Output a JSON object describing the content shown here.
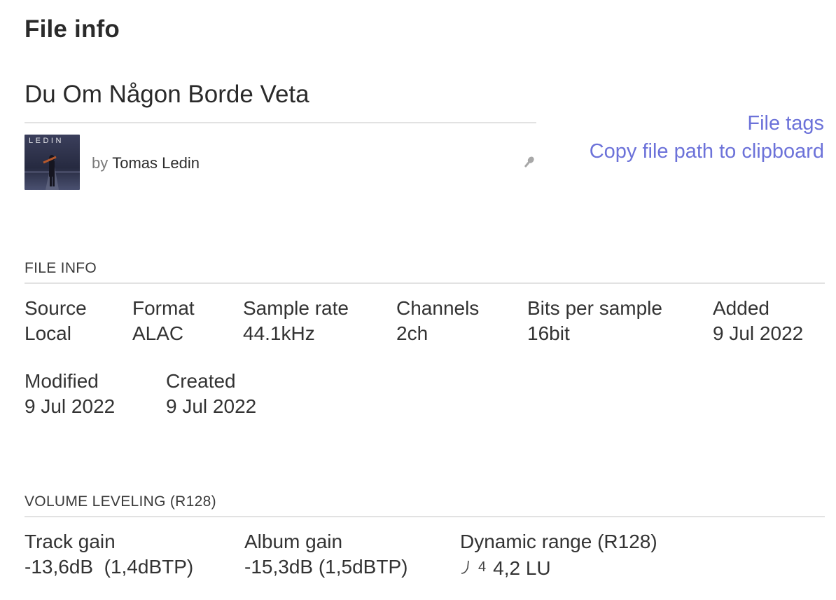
{
  "header": {
    "title": "File info"
  },
  "track": {
    "title": "Du Om Någon Borde Veta",
    "cover_text": "LEDIN",
    "by_label": "by",
    "artist": "Tomas Ledin"
  },
  "links": {
    "file_tags": "File tags",
    "copy_path": "Copy file path to clipboard"
  },
  "file_info": {
    "header": "FILE INFO",
    "fields": [
      {
        "label": "Source",
        "value": "Local"
      },
      {
        "label": "Format",
        "value": "ALAC"
      },
      {
        "label": "Sample rate",
        "value": "44.1kHz"
      },
      {
        "label": "Channels",
        "value": "2ch"
      },
      {
        "label": "Bits per sample",
        "value": "16bit"
      },
      {
        "label": "Added",
        "value": "9 Jul 2022"
      },
      {
        "label": "Modified",
        "value": "9 Jul 2022"
      },
      {
        "label": "Created",
        "value": "9 Jul 2022"
      }
    ]
  },
  "volume_leveling": {
    "header": "VOLUME LEVELING (R128)",
    "track_gain": {
      "label": "Track gain",
      "value": "-13,6dB  (1,4dBTP)"
    },
    "album_gain": {
      "label": "Album gain",
      "value": "-15,3dB (1,5dBTP)"
    },
    "dynamic_range": {
      "label": "Dynamic range (R128)",
      "badge": "4",
      "value": "4,2 LU"
    }
  },
  "colors": {
    "link": "#6c72d9",
    "divider": "#e2e2e2",
    "text": "#2b2b2b"
  },
  "icons": {
    "microphone": "microphone-icon",
    "dynamic_range": "dynamic-range-icon"
  }
}
